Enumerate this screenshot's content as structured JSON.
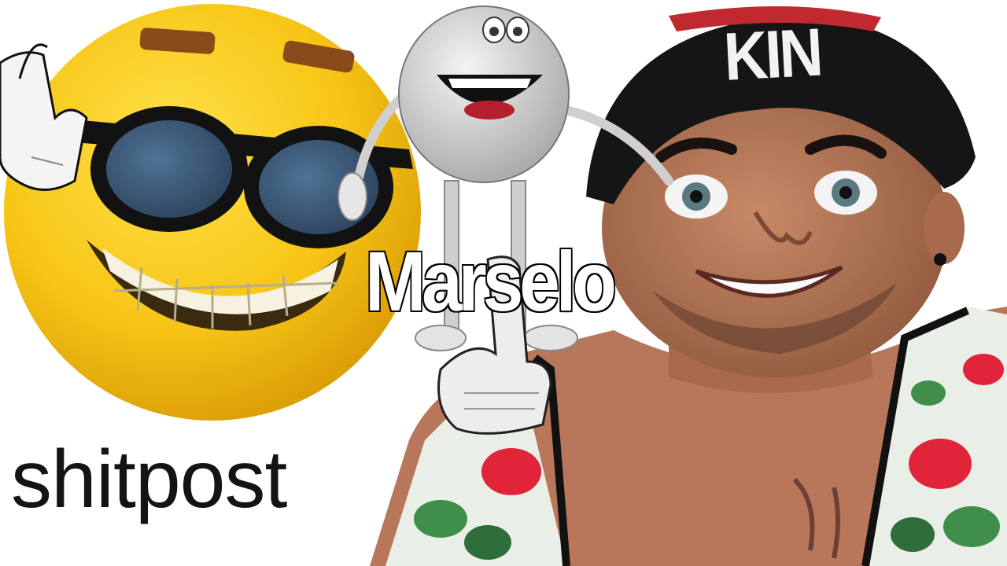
{
  "image": {
    "caption_text": "shitpost",
    "overlay_title": "Marselo",
    "cap_text": "KIN"
  },
  "colors": {
    "emoji_yellow": "#f7c516",
    "sunglasses": "#121212",
    "lens": "#3f5d7c",
    "character_gray": "#d9d9d9",
    "skin": "#b07254",
    "cap": "#151515",
    "floral_red": "#e0243a",
    "leaf_green": "#3f8f4a"
  }
}
